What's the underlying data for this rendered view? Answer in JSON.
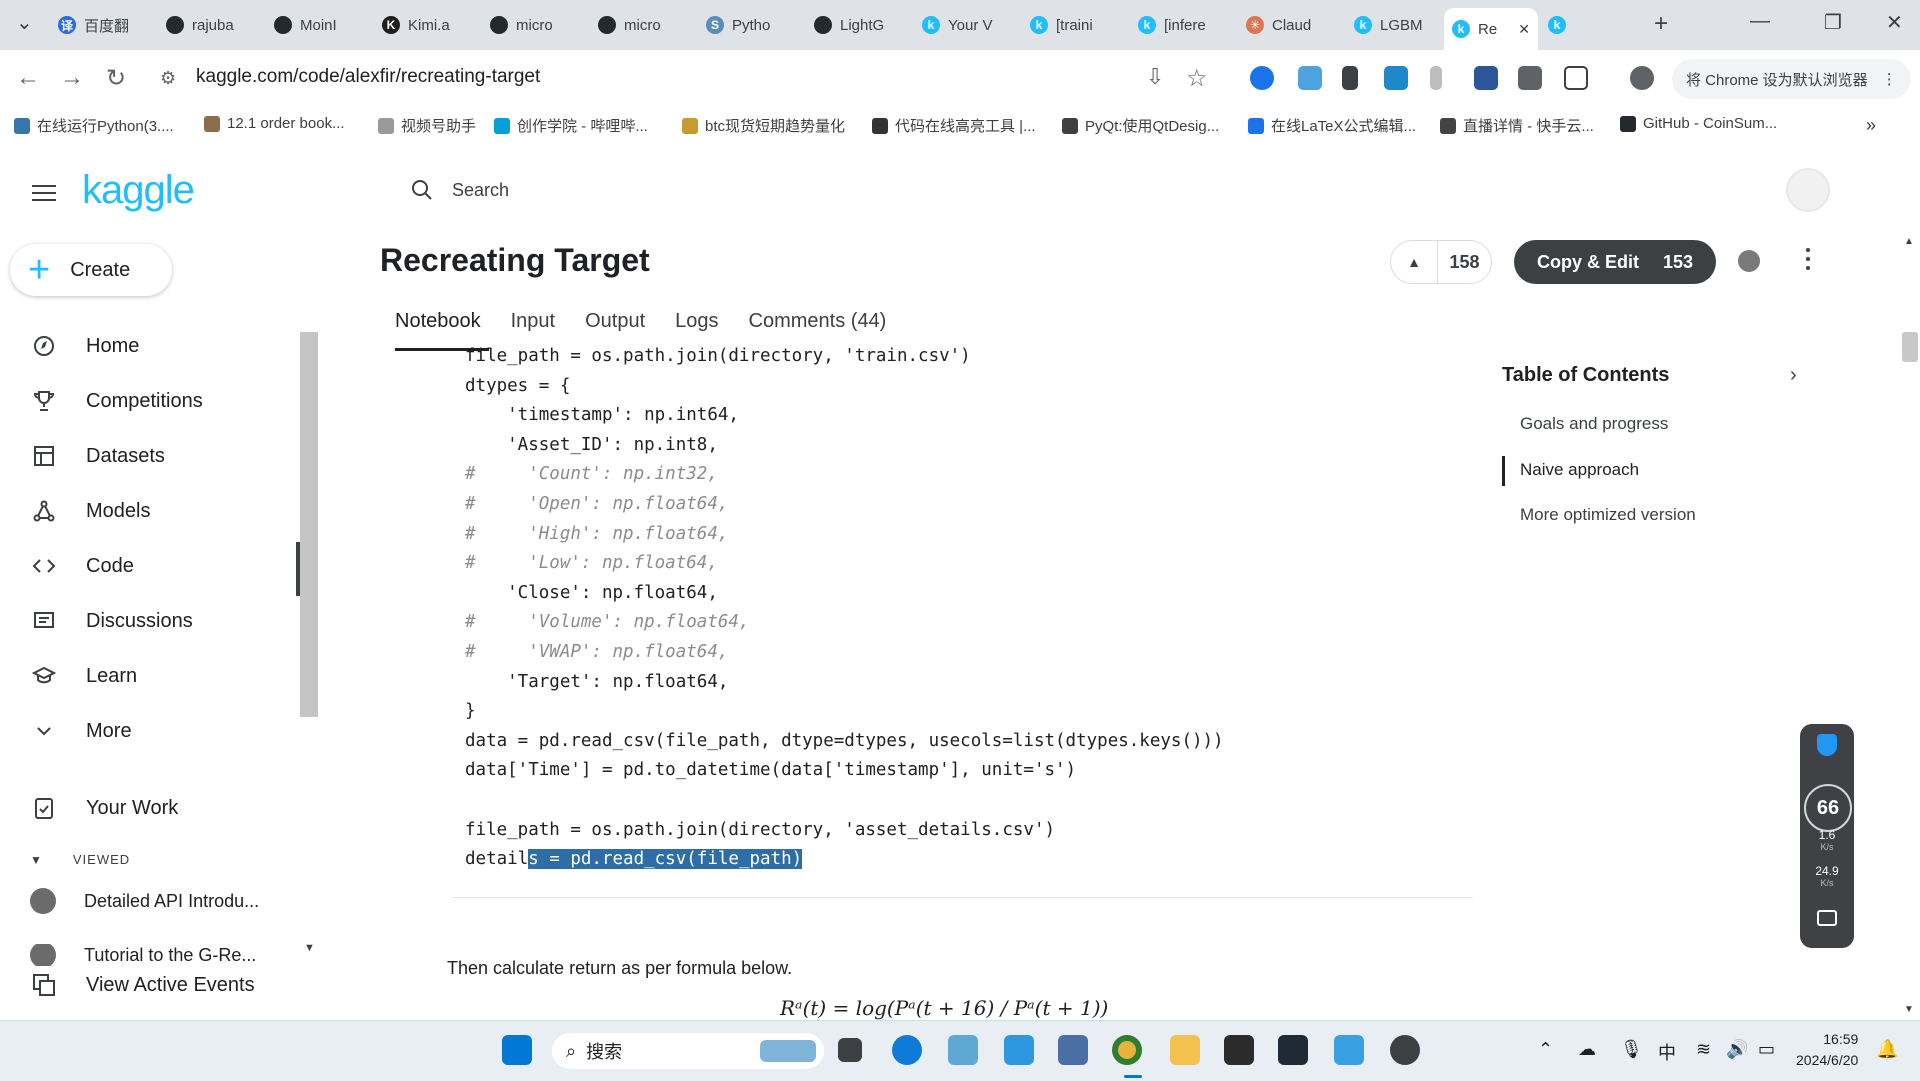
{
  "tabs": [
    {
      "label": "百度翻",
      "color": "#2a6ae9",
      "glyph": "译"
    },
    {
      "label": "rajuba",
      "color": "#24292f",
      "glyph": ""
    },
    {
      "label": "MoinI",
      "color": "#24292f",
      "glyph": ""
    },
    {
      "label": "Kimi.a",
      "color": "#1f1f1f",
      "glyph": "K"
    },
    {
      "label": "micro",
      "color": "#24292f",
      "glyph": ""
    },
    {
      "label": "micro",
      "color": "#24292f",
      "glyph": ""
    },
    {
      "label": "Pytho",
      "color": "#5b8db8",
      "glyph": "S"
    },
    {
      "label": "LightG",
      "color": "#24292f",
      "glyph": ""
    },
    {
      "label": "Your V",
      "color": "#20beff",
      "glyph": "k"
    },
    {
      "label": "[traini",
      "color": "#20beff",
      "glyph": "k"
    },
    {
      "label": "[infere",
      "color": "#20beff",
      "glyph": "k"
    },
    {
      "label": "Claud",
      "color": "#d97757",
      "glyph": "✳"
    },
    {
      "label": "LGBM",
      "color": "#20beff",
      "glyph": "k"
    },
    {
      "label": "Re",
      "color": "#20beff",
      "glyph": "k",
      "active": true
    },
    {
      "label": "",
      "color": "#20beff",
      "glyph": "k"
    }
  ],
  "url": "kaggle.com/code/alexfir/recreating-target",
  "default_browser_label": "将 Chrome 设为默认浏览器",
  "bookmarks": [
    "在线运行Python(3....",
    "12.1 order book...",
    "视频号助手",
    "创作学院 - 哔哩哔...",
    "btc现货短期趋势量化",
    "代码在线高亮工具 |...",
    "PyQt:使用QtDesig...",
    "在线LaTeX公式编辑...",
    "直播详情 - 快手云...",
    "GitHub - CoinSum..."
  ],
  "kaggle": {
    "logo": "kaggle",
    "create": "Create",
    "search_placeholder": "Search",
    "nav": [
      "Home",
      "Competitions",
      "Datasets",
      "Models",
      "Code",
      "Discussions",
      "Learn",
      "More"
    ],
    "your_work": "Your Work",
    "viewed_header": "VIEWED",
    "viewed": [
      "Detailed API Introdu...",
      "Tutorial to the G-Re..."
    ],
    "view_active_events": "View Active Events",
    "notebook_title": "Recreating Target",
    "votes": "158",
    "copy_edit_label": "Copy & Edit",
    "copy_edit_count": "153",
    "notebook_tabs": [
      "Notebook",
      "Input",
      "Output",
      "Logs",
      "Comments (44)"
    ],
    "code_lines": [
      "file_path = os.path.join(directory, 'train.csv')",
      "dtypes = {",
      "    'timestamp': np.int64,",
      "    'Asset_ID': np.int8,",
      "#     'Count': np.int32,",
      "#     'Open': np.float64,",
      "#     'High': np.float64,",
      "#     'Low': np.float64,",
      "    'Close': np.float64,",
      "#     'Volume': np.float64,",
      "#     'VWAP': np.float64,",
      "    'Target': np.float64,",
      "}",
      "data = pd.read_csv(file_path, dtype=dtypes, usecols=list(dtypes.keys()))",
      "data['Time'] = pd.to_datetime(data['timestamp'], unit='s')",
      "",
      "file_path = os.path.join(directory, 'asset_details.csv')",
      "details = pd.read_csv(file_path)"
    ],
    "code_last_plain": "detail",
    "code_last_selected": "s = pd.read_csv(file_path)",
    "paragraph": "Then calculate return as per formula below.",
    "formula": "Rᵃ(t) = log(Pᵃ(t + 16) / Pᵃ(t + 1))",
    "toc_title": "Table of Contents",
    "toc_items": [
      "Goals and progress",
      "Naive approach",
      "More optimized version"
    ]
  },
  "speed_widget": {
    "percent": "66",
    "up": "1.6",
    "up_unit": "K/s",
    "down": "24.9",
    "down_unit": "K/s"
  },
  "taskbar": {
    "search": "搜索",
    "ime": "中",
    "time": "16:59",
    "date": "2024/6/20"
  }
}
